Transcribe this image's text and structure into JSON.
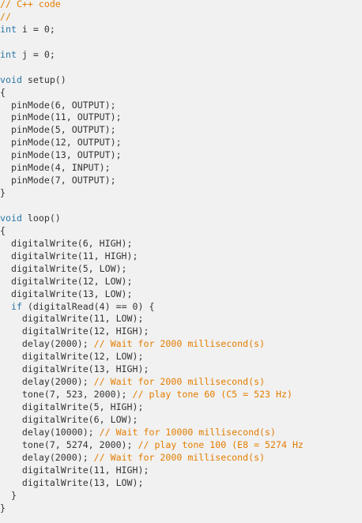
{
  "editor": {
    "language_comment": "// C++ code",
    "lines": [
      [
        [
          "c",
          "// C++ code"
        ]
      ],
      [
        [
          "c",
          "//"
        ]
      ],
      [
        [
          "k",
          "int"
        ],
        [
          "p",
          " i = 0;"
        ]
      ],
      [],
      [
        [
          "k",
          "int"
        ],
        [
          "p",
          " j = 0;"
        ]
      ],
      [],
      [
        [
          "k",
          "void"
        ],
        [
          "p",
          " setup()"
        ]
      ],
      [
        [
          "p",
          "{"
        ]
      ],
      [
        [
          "p",
          "  pinMode(6, OUTPUT);"
        ]
      ],
      [
        [
          "p",
          "  pinMode(11, OUTPUT);"
        ]
      ],
      [
        [
          "p",
          "  pinMode(5, OUTPUT);"
        ]
      ],
      [
        [
          "p",
          "  pinMode(12, OUTPUT);"
        ]
      ],
      [
        [
          "p",
          "  pinMode(13, OUTPUT);"
        ]
      ],
      [
        [
          "p",
          "  pinMode(4, INPUT);"
        ]
      ],
      [
        [
          "p",
          "  pinMode(7, OUTPUT);"
        ]
      ],
      [
        [
          "p",
          "}"
        ]
      ],
      [],
      [
        [
          "k",
          "void"
        ],
        [
          "p",
          " loop()"
        ]
      ],
      [
        [
          "p",
          "{"
        ]
      ],
      [
        [
          "p",
          "  digitalWrite(6, HIGH);"
        ]
      ],
      [
        [
          "p",
          "  digitalWrite(11, HIGH);"
        ]
      ],
      [
        [
          "p",
          "  digitalWrite(5, LOW);"
        ]
      ],
      [
        [
          "p",
          "  digitalWrite(12, LOW);"
        ]
      ],
      [
        [
          "p",
          "  digitalWrite(13, LOW);"
        ]
      ],
      [
        [
          "p",
          "  "
        ],
        [
          "k",
          "if"
        ],
        [
          "p",
          " (digitalRead(4) == 0) {"
        ]
      ],
      [
        [
          "p",
          "    digitalWrite(11, LOW);"
        ]
      ],
      [
        [
          "p",
          "    digitalWrite(12, HIGH);"
        ]
      ],
      [
        [
          "p",
          "    delay(2000); "
        ],
        [
          "c",
          "// Wait for 2000 millisecond(s)"
        ]
      ],
      [
        [
          "p",
          "    digitalWrite(12, LOW);"
        ]
      ],
      [
        [
          "p",
          "    digitalWrite(13, HIGH);"
        ]
      ],
      [
        [
          "p",
          "    delay(2000); "
        ],
        [
          "c",
          "// Wait for 2000 millisecond(s)"
        ]
      ],
      [
        [
          "p",
          "    tone(7, 523, 2000); "
        ],
        [
          "c",
          "// play tone 60 (C5 = 523 Hz)"
        ]
      ],
      [
        [
          "p",
          "    digitalWrite(5, HIGH);"
        ]
      ],
      [
        [
          "p",
          "    digitalWrite(6, LOW);"
        ]
      ],
      [
        [
          "p",
          "    delay(10000); "
        ],
        [
          "c",
          "// Wait for 10000 millisecond(s)"
        ]
      ],
      [
        [
          "p",
          "    tone(7, 5274, 2000); "
        ],
        [
          "c",
          "// play tone 100 (E8 = 5274 Hz"
        ]
      ],
      [
        [
          "p",
          "    delay(2000); "
        ],
        [
          "c",
          "// Wait for 2000 millisecond(s)"
        ]
      ],
      [
        [
          "p",
          "    digitalWrite(11, HIGH);"
        ]
      ],
      [
        [
          "p",
          "    digitalWrite(13, LOW);"
        ]
      ],
      [
        [
          "p",
          "  }"
        ]
      ],
      [
        [
          "p",
          "}"
        ]
      ]
    ]
  },
  "colors": {
    "background": "#f1f1f1",
    "text": "#333333",
    "keyword": "#2a76a7",
    "comment": "#e37d00"
  }
}
